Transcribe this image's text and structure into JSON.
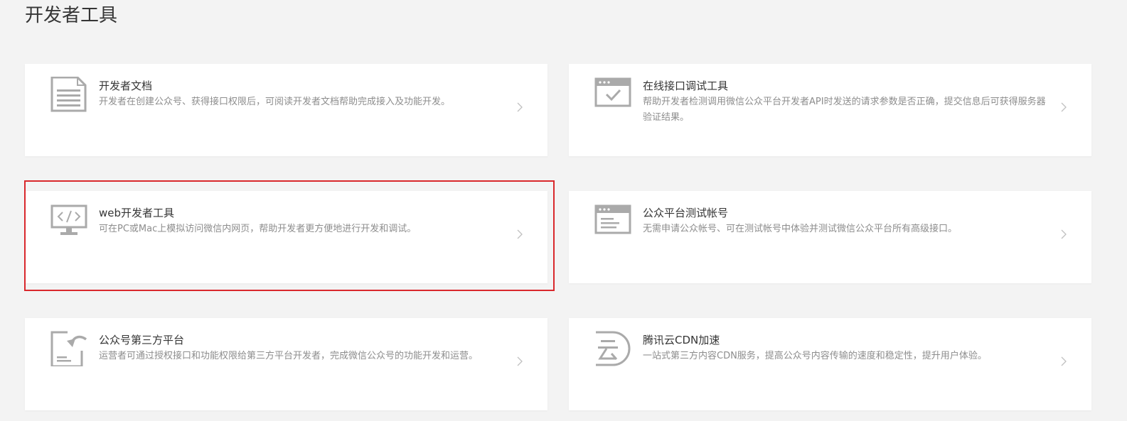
{
  "page": {
    "title": "开发者工具"
  },
  "colors": {
    "background": "#f3f3f3",
    "card": "#ffffff",
    "icon": "#aaaaaa",
    "title_text": "#353535",
    "desc_text": "#8d8d8d",
    "highlight_border": "#d9282c"
  },
  "tools": [
    {
      "icon": "document-icon",
      "title": "开发者文档",
      "desc": "开发者在创建公众号、获得接口权限后，可阅读开发者文档帮助完成接入及功能开发。"
    },
    {
      "icon": "browser-check-icon",
      "title": "在线接口调试工具",
      "desc": "帮助开发者检测调用微信公众平台开发者API时发送的请求参数是否正确，提交信息后可获得服务器验证结果。"
    },
    {
      "icon": "monitor-code-icon",
      "title": "web开发者工具",
      "desc": "可在PC或Mac上模拟访问微信内网页，帮助开发者更方便地进行开发和调试。"
    },
    {
      "icon": "browser-list-icon",
      "title": "公众平台测试帐号",
      "desc": "无需申请公众帐号、可在测试帐号中体验并测试微信公众平台所有高级接口。"
    },
    {
      "icon": "doc-return-icon",
      "title": "公众号第三方平台",
      "desc": "运营者可通过授权接口和功能权限给第三方平台开发者，完成微信公众号的功能开发和运营。"
    },
    {
      "icon": "cloud-yun-icon",
      "title": "腾讯云CDN加速",
      "desc": "一站式第三方内容CDN服务，提高公众号内容传输的速度和稳定性，提升用户体验。"
    }
  ]
}
